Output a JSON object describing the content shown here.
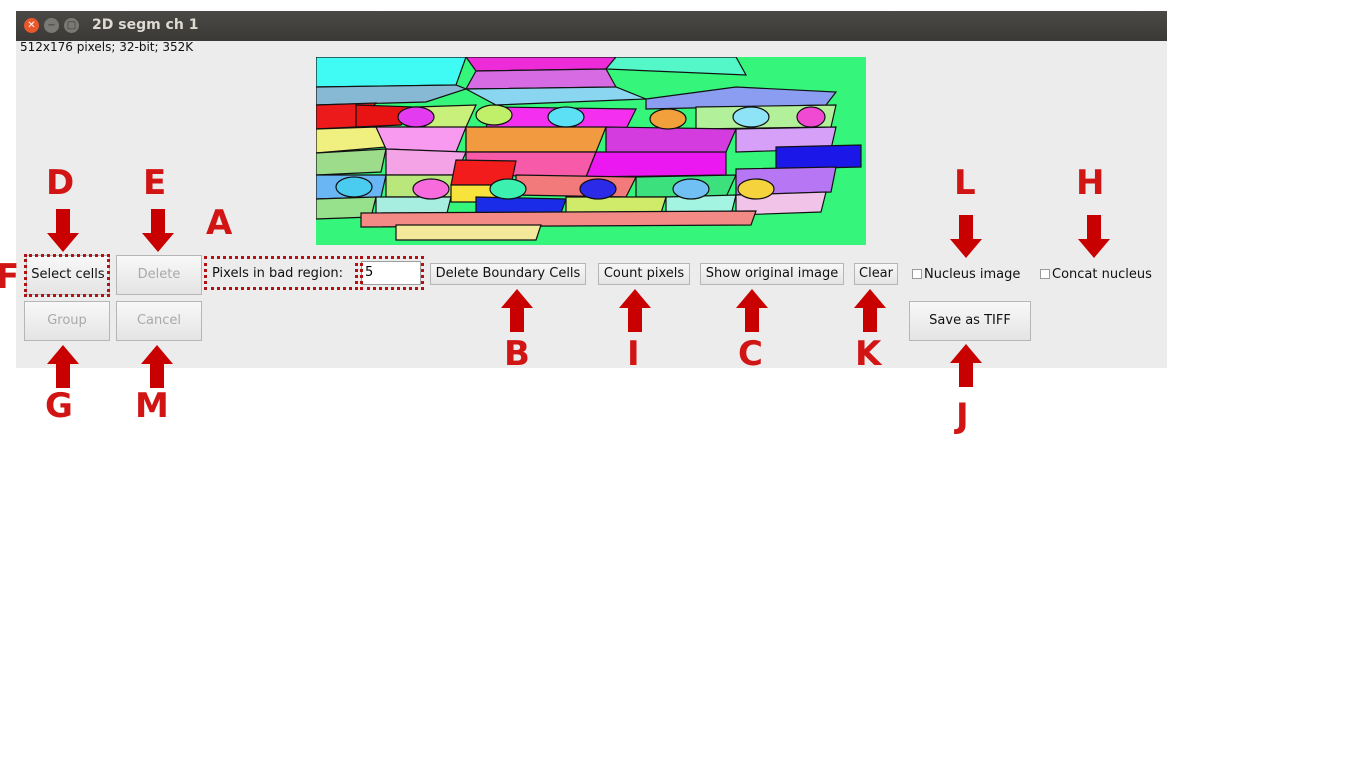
{
  "window": {
    "title": "2D segm ch 1",
    "info": "512x176 pixels; 32-bit; 352K"
  },
  "controls": {
    "select_cells": "Select cells",
    "delete": "Delete",
    "pixels_label": "Pixels in bad region:",
    "pixels_value": "5",
    "delete_boundary": "Delete Boundary Cells",
    "count_pixels": "Count pixels",
    "show_original": "Show original image",
    "clear": "Clear",
    "nucleus_image": "Nucleus image",
    "concat_nucleus": "Concat nucleus",
    "group": "Group",
    "cancel": "Cancel",
    "save_tiff": "Save as TIFF"
  },
  "annotations": {
    "D": "D",
    "E": "E",
    "A": "A",
    "L": "L",
    "H": "H",
    "F": "F",
    "G": "G",
    "M": "M",
    "B": "B",
    "I": "I",
    "C": "C",
    "K": "K",
    "J": "J"
  },
  "colors": {
    "annotation": "#d11515",
    "arrow": "#c80000",
    "titlebar": "#3d3c39",
    "window_bg": "#ececec",
    "image_bg": "#35f57a"
  }
}
